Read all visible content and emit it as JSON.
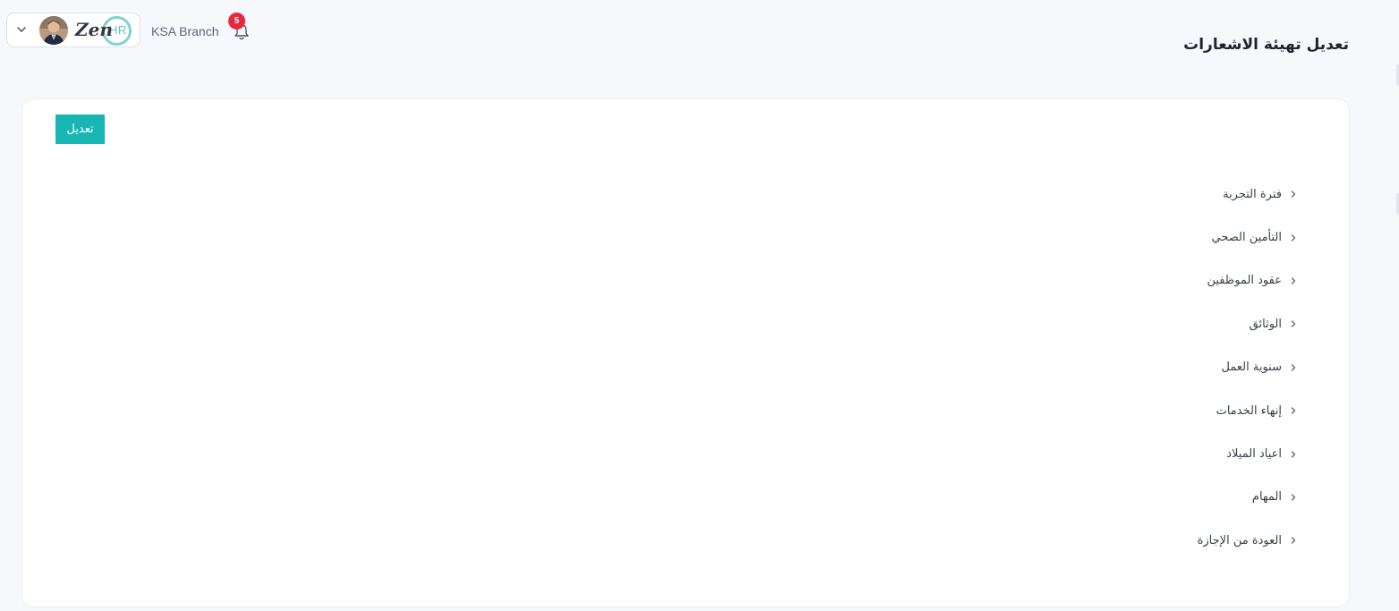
{
  "header": {
    "branch_name": "KSA Branch",
    "notification_count": "5",
    "logo_text_zen": "Zen",
    "logo_text_hr": "HR",
    "page_title": "تعديل تهيئة الاشعارات"
  },
  "card": {
    "edit_button_label": "تعديل",
    "sections": [
      {
        "label": "فترة التجربة"
      },
      {
        "label": "التأمين الصحي"
      },
      {
        "label": "عقود الموظفين"
      },
      {
        "label": "الوثائق"
      },
      {
        "label": "سنوية العمل"
      },
      {
        "label": "إنهاء الخدمات"
      },
      {
        "label": "اعياد الميلاد"
      },
      {
        "label": "المهام"
      },
      {
        "label": "العودة من الإجازة"
      }
    ]
  },
  "colors": {
    "accent": "#17b6b2",
    "badge": "#e6283c",
    "logo_ring": "#7fd3cf"
  },
  "icons": {
    "pill": "chevron-down-icon",
    "notifications": "bell-icon",
    "section_toggle": "chevron-right-icon"
  }
}
